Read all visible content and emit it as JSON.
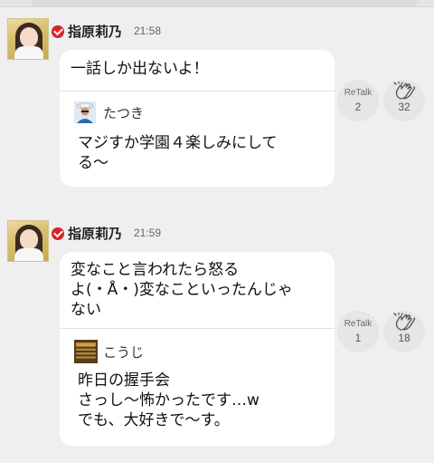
{
  "posts": [
    {
      "author": "指原莉乃",
      "time": "21:58",
      "message": "一話しか出ないよ！",
      "quote": {
        "author": "たつき",
        "text": "マジすか学園４楽しみにして\nる〜"
      },
      "retalk_label": "ReTalk",
      "retalk_count": "2",
      "clap_count": "32"
    },
    {
      "author": "指原莉乃",
      "time": "21:59",
      "message": "変なこと言われたら怒る\nよ(・Å・)変なこといったんじゃ\nない",
      "quote": {
        "author": "こうじ",
        "text": "昨日の握手会\nさっし〜怖かったです…w\nでも、大好きで〜す。"
      },
      "retalk_label": "ReTalk",
      "retalk_count": "1",
      "clap_count": "18"
    }
  ],
  "icons": {
    "verified": "verified-check-icon",
    "clap": "clap-hands-icon"
  },
  "colors": {
    "background": "#efefef",
    "bubble": "#ffffff",
    "verified_badge": "#d8232a",
    "action_circle": "#e6e6e6"
  }
}
